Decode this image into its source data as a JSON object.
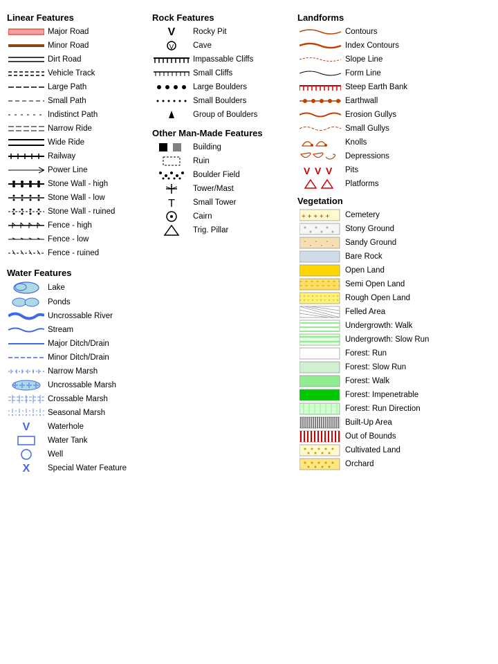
{
  "sections": {
    "linear_features": {
      "title": "Linear Features",
      "items": [
        {
          "label": "Major Road",
          "symbol_type": "major-road"
        },
        {
          "label": "Minor Road",
          "symbol_type": "minor-road"
        },
        {
          "label": "Dirt Road",
          "symbol_type": "dirt-road"
        },
        {
          "label": "Vehicle Track",
          "symbol_type": "vehicle-track"
        },
        {
          "label": "Large Path",
          "symbol_type": "large-path"
        },
        {
          "label": "Small Path",
          "symbol_type": "small-path"
        },
        {
          "label": "Indistinct Path",
          "symbol_type": "indistinct-path"
        },
        {
          "label": "Narrow Ride",
          "symbol_type": "narrow-ride"
        },
        {
          "label": "Wide Ride",
          "symbol_type": "wide-ride"
        },
        {
          "label": "Railway",
          "symbol_type": "railway"
        },
        {
          "label": "Power Line",
          "symbol_type": "power-line"
        },
        {
          "label": "Stone Wall - high",
          "symbol_type": "stone-wall-high"
        },
        {
          "label": "Stone  Wall - low",
          "symbol_type": "stone-wall-low"
        },
        {
          "label": "Stone  Wall - ruined",
          "symbol_type": "stone-wall-ruined"
        },
        {
          "label": "Fence - high",
          "symbol_type": "fence-high"
        },
        {
          "label": "Fence - low",
          "symbol_type": "fence-low"
        },
        {
          "label": "Fence - ruined",
          "symbol_type": "fence-ruined"
        }
      ]
    },
    "water_features": {
      "title": "Water Features",
      "items": [
        {
          "label": "Lake",
          "symbol_type": "water-lake"
        },
        {
          "label": "Ponds",
          "symbol_type": "water-ponds"
        },
        {
          "label": "Uncrossable River",
          "symbol_type": "water-uncrossable-river"
        },
        {
          "label": "Stream",
          "symbol_type": "water-stream"
        },
        {
          "label": "Major Ditch/Drain",
          "symbol_type": "water-major-ditch"
        },
        {
          "label": "Minor Ditch/Drain",
          "symbol_type": "water-minor-ditch"
        },
        {
          "label": "Narrow Marsh",
          "symbol_type": "water-narrow-marsh"
        },
        {
          "label": "Uncrossable Marsh",
          "symbol_type": "water-uncrossable-marsh"
        },
        {
          "label": "Crossable Marsh",
          "symbol_type": "water-crossable-marsh"
        },
        {
          "label": "Seasonal Marsh",
          "symbol_type": "water-seasonal-marsh"
        },
        {
          "label": "Waterhole",
          "symbol_type": "water-waterhole"
        },
        {
          "label": "Water Tank",
          "symbol_type": "water-tank"
        },
        {
          "label": "Well",
          "symbol_type": "water-well"
        },
        {
          "label": "Special Water Feature",
          "symbol_type": "water-special"
        }
      ]
    },
    "rock_features": {
      "title": "Rock Features",
      "items": [
        {
          "label": "Rocky Pit",
          "symbol_type": "rock-rocky-pit"
        },
        {
          "label": "Cave",
          "symbol_type": "rock-cave"
        },
        {
          "label": "Impassable Cliffs",
          "symbol_type": "rock-impassable-cliffs"
        },
        {
          "label": "Small Cliffs",
          "symbol_type": "rock-small-cliffs"
        },
        {
          "label": "Large Boulders",
          "symbol_type": "rock-large-boulders"
        },
        {
          "label": "Small Boulders",
          "symbol_type": "rock-small-boulders"
        },
        {
          "label": "Group of Boulders",
          "symbol_type": "rock-group-boulders"
        }
      ]
    },
    "man_made": {
      "title": "Other Man-Made Features",
      "items": [
        {
          "label": "Building",
          "symbol_type": "mm-building"
        },
        {
          "label": "Ruin",
          "symbol_type": "mm-ruin"
        },
        {
          "label": "Boulder Field",
          "symbol_type": "mm-boulder-field"
        },
        {
          "label": "Tower/Mast",
          "symbol_type": "mm-tower-mast"
        },
        {
          "label": "Small Tower",
          "symbol_type": "mm-small-tower"
        },
        {
          "label": "Cairn",
          "symbol_type": "mm-cairn"
        },
        {
          "label": "Trig. Pillar",
          "symbol_type": "mm-trig-pillar"
        }
      ]
    },
    "landforms": {
      "title": "Landforms",
      "items": [
        {
          "label": "Contours",
          "symbol_type": "lf-contours"
        },
        {
          "label": "Index Contours",
          "symbol_type": "lf-index-contours"
        },
        {
          "label": "Slope Line",
          "symbol_type": "lf-slope-line"
        },
        {
          "label": "Form Line",
          "symbol_type": "lf-form-line"
        },
        {
          "label": "Steep Earth Bank",
          "symbol_type": "lf-steep-earth-bank"
        },
        {
          "label": "Earthwall",
          "symbol_type": "lf-earthwall"
        },
        {
          "label": "Erosion Gullys",
          "symbol_type": "lf-erosion-gullys"
        },
        {
          "label": "Small Gullys",
          "symbol_type": "lf-small-gullys"
        },
        {
          "label": "Knolls",
          "symbol_type": "lf-knolls"
        },
        {
          "label": "Depressions",
          "symbol_type": "lf-depressions"
        },
        {
          "label": "Pits",
          "symbol_type": "lf-pits"
        },
        {
          "label": "Platforms",
          "symbol_type": "lf-platforms"
        }
      ]
    },
    "vegetation": {
      "title": "Vegetation",
      "items": [
        {
          "label": "Cemetery",
          "swatch": "cemetery"
        },
        {
          "label": "Stony Ground",
          "swatch": "stony-ground"
        },
        {
          "label": "Sandy Ground",
          "swatch": "sandy-ground"
        },
        {
          "label": "Bare Rock",
          "swatch": "bare-rock"
        },
        {
          "label": "Open Land",
          "swatch": "open-land"
        },
        {
          "label": "Semi Open Land",
          "swatch": "semi-open"
        },
        {
          "label": "Rough Open Land",
          "swatch": "rough-open"
        },
        {
          "label": "Felled Area",
          "swatch": "felled"
        },
        {
          "label": "Undergrowth: Walk",
          "swatch": "undergrowth-walk"
        },
        {
          "label": "Undergrowth: Slow Run",
          "swatch": "undergrowth-slow"
        },
        {
          "label": "Forest: Run",
          "swatch": "forest-run"
        },
        {
          "label": "Forest: Slow Run",
          "swatch": "forest-slow"
        },
        {
          "label": "Forest: Walk",
          "swatch": "forest-walk"
        },
        {
          "label": "Forest: Impenetrable",
          "swatch": "forest-impenetrable"
        },
        {
          "label": "Forest: Run Direction",
          "swatch": "forest-run-dir"
        },
        {
          "label": "Built-Up Area",
          "swatch": "built-up"
        },
        {
          "label": "Out of Bounds",
          "swatch": "out-of-bounds"
        },
        {
          "label": "Cultivated Land",
          "swatch": "cultivated"
        },
        {
          "label": "Orchard",
          "swatch": "orchard"
        }
      ]
    }
  }
}
